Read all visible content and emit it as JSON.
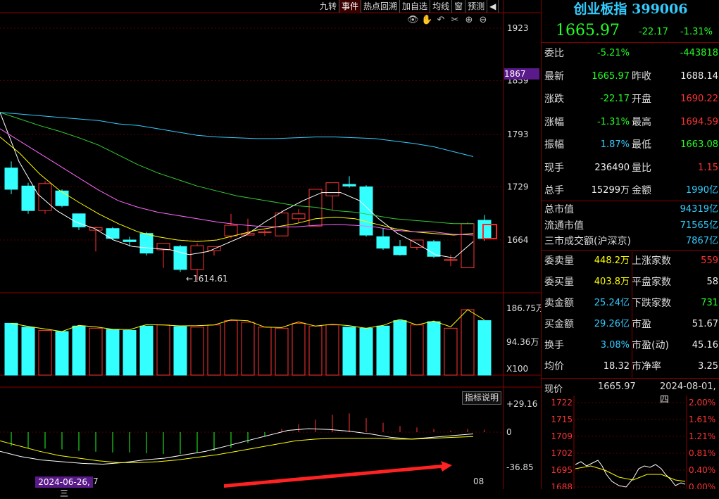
{
  "toolbar": [
    "九转",
    "事件",
    "热点回溯",
    "加自选",
    "均线",
    "窗",
    "预测"
  ],
  "toolbar_active": 1,
  "chart_tools": [
    "eye-icon",
    "hand-icon",
    "undo-icon",
    "scissors-icon",
    "zoom-in-icon",
    "zoom-out-icon"
  ],
  "price_axis": {
    "labels": [
      "1923",
      "1859",
      "1793",
      "1729",
      "1664"
    ],
    "current": "1867"
  },
  "low_marker": "1614.61",
  "vol_axis": [
    "186.75万",
    "94.36万",
    "X100"
  ],
  "macd_axis": [
    "+29.16",
    "0",
    "-36.85"
  ],
  "brief_label": "指标说明",
  "bottom": {
    "date": "2024-06-26,三",
    "date_tail": "7",
    "end": "08"
  },
  "colors": {
    "up": "#f33",
    "down": "#3ff",
    "ma5": "#fff",
    "ma10": "#ff0",
    "ma20": "#f6f",
    "ma30": "#3c3",
    "ma60": "#3cf"
  },
  "chart_data": {
    "type": "candlestick",
    "candles": [
      {
        "o": 1752,
        "h": 1760,
        "l": 1720,
        "c": 1726
      },
      {
        "o": 1730,
        "h": 1734,
        "l": 1696,
        "c": 1700
      },
      {
        "o": 1700,
        "h": 1736,
        "l": 1696,
        "c": 1733
      },
      {
        "o": 1724,
        "h": 1726,
        "l": 1704,
        "c": 1706
      },
      {
        "o": 1696,
        "h": 1696,
        "l": 1676,
        "c": 1680
      },
      {
        "o": 1676,
        "h": 1680,
        "l": 1650,
        "c": 1679
      },
      {
        "o": 1678,
        "h": 1680,
        "l": 1664,
        "c": 1666
      },
      {
        "o": 1664,
        "h": 1668,
        "l": 1656,
        "c": 1662
      },
      {
        "o": 1672,
        "h": 1674,
        "l": 1645,
        "c": 1648
      },
      {
        "o": 1652,
        "h": 1660,
        "l": 1630,
        "c": 1660
      },
      {
        "o": 1656,
        "h": 1658,
        "l": 1625,
        "c": 1628
      },
      {
        "o": 1628,
        "h": 1660,
        "l": 1614.61,
        "c": 1657
      },
      {
        "o": 1651,
        "h": 1656,
        "l": 1645,
        "c": 1656
      },
      {
        "o": 1669,
        "h": 1696,
        "l": 1666,
        "c": 1682
      },
      {
        "o": 1670,
        "h": 1690,
        "l": 1670,
        "c": 1672
      },
      {
        "o": 1674,
        "h": 1676,
        "l": 1669,
        "c": 1674
      },
      {
        "o": 1669,
        "h": 1700,
        "l": 1669,
        "c": 1697
      },
      {
        "o": 1690,
        "h": 1702,
        "l": 1685,
        "c": 1696
      },
      {
        "o": 1681,
        "h": 1726,
        "l": 1681,
        "c": 1726
      },
      {
        "o": 1718,
        "h": 1734,
        "l": 1700,
        "c": 1734
      },
      {
        "o": 1732,
        "h": 1742,
        "l": 1728,
        "c": 1730
      },
      {
        "o": 1729,
        "h": 1731,
        "l": 1668,
        "c": 1670
      },
      {
        "o": 1668,
        "h": 1678,
        "l": 1652,
        "c": 1654
      },
      {
        "o": 1656,
        "h": 1664,
        "l": 1645,
        "c": 1646
      },
      {
        "o": 1655,
        "h": 1664,
        "l": 1652,
        "c": 1664
      },
      {
        "o": 1662,
        "h": 1664,
        "l": 1642,
        "c": 1644
      },
      {
        "o": 1640,
        "h": 1646,
        "l": 1632,
        "c": 1640
      },
      {
        "o": 1630,
        "h": 1686,
        "l": 1630,
        "c": 1684
      },
      {
        "o": 1688.14,
        "h": 1694.59,
        "l": 1663.08,
        "c": 1665.97
      }
    ],
    "ma": [
      {
        "name": "MA5",
        "points": [
          1820,
          1760,
          1720,
          1700,
          1686,
          1678,
          1664,
          1656,
          1654,
          1652,
          1646,
          1650,
          1660,
          1670,
          1686,
          1700,
          1712,
          1722,
          1722,
          1712,
          1690,
          1672,
          1660,
          1646,
          1642,
          1662
        ]
      },
      {
        "name": "MA10",
        "points": [
          1790,
          1770,
          1745,
          1725,
          1710,
          1696,
          1684,
          1674,
          1668,
          1664,
          1662,
          1664,
          1670,
          1676,
          1680,
          1684,
          1690,
          1692,
          1690,
          1684,
          1678,
          1674,
          1672,
          1670,
          1672
        ]
      },
      {
        "name": "MA20",
        "points": [
          1800,
          1785,
          1770,
          1755,
          1740,
          1725,
          1712,
          1704,
          1698,
          1694,
          1690,
          1686,
          1683,
          1681,
          1680,
          1680,
          1682,
          1683,
          1682,
          1680,
          1676,
          1674,
          1674,
          1671,
          1670
        ]
      },
      {
        "name": "MA30",
        "points": [
          1820,
          1812,
          1804,
          1797,
          1789,
          1780,
          1768,
          1756,
          1746,
          1738,
          1730,
          1724,
          1718,
          1714,
          1710,
          1706,
          1704,
          1700,
          1698,
          1694,
          1690,
          1688,
          1686,
          1684,
          1684
        ]
      },
      {
        "name": "MA60",
        "points": [
          1820,
          1818,
          1816,
          1814,
          1812,
          1810,
          1806,
          1804,
          1800,
          1796,
          1792,
          1790,
          1789,
          1788,
          1788,
          1789,
          1790,
          1790,
          1789,
          1788,
          1785,
          1782,
          1778,
          1772,
          1766
        ]
      }
    ],
    "volumes": [
      95,
      88,
      82,
      80,
      90,
      86,
      84,
      82,
      90,
      92,
      89,
      88,
      92,
      100,
      97,
      88,
      86,
      95,
      90,
      92,
      88,
      86,
      90,
      100,
      92,
      98,
      86,
      120,
      100
    ],
    "macd_bars": [
      -18,
      -20,
      -21,
      -22,
      -24,
      -25,
      -26,
      -26,
      -27,
      -28,
      -28,
      -26,
      -24,
      -20,
      -14,
      -6,
      4,
      10,
      16,
      22,
      24,
      18,
      12,
      8,
      6,
      4,
      2,
      4,
      3
    ],
    "macd_dif": [
      -22,
      -28,
      -32,
      -34,
      -36,
      -36.85,
      -35,
      -32,
      -30,
      -26,
      -22,
      -16,
      -10,
      -4,
      2,
      4,
      3,
      1,
      -2,
      -6,
      -8,
      -6,
      -4,
      -2
    ],
    "macd_dea": [
      -10,
      -16,
      -22,
      -27,
      -30,
      -33,
      -35,
      -35,
      -34,
      -32,
      -29,
      -26,
      -22,
      -18,
      -14,
      -10,
      -8,
      -7,
      -7,
      -7,
      -8,
      -8,
      -7,
      -6,
      -5
    ]
  },
  "panel": {
    "title": "创业板指 399006",
    "price": "1665.97",
    "chg": "-22.17",
    "pct": "-1.31%",
    "rows1": [
      {
        "l": "委比",
        "v1": "-5.21%",
        "c1": "g",
        "v2": "-443818",
        "c2": "g"
      },
      {
        "l": "最新",
        "v1": "1665.97",
        "c1": "g",
        "l2": "昨收",
        "v2": "1688.14",
        "c2": "w"
      },
      {
        "l": "涨跌",
        "v1": "-22.17",
        "c1": "g",
        "l2": "开盘",
        "v2": "1690.22",
        "c2": "r"
      },
      {
        "l": "涨幅",
        "v1": "-1.31%",
        "c1": "g",
        "l2": "最高",
        "v2": "1694.59",
        "c2": "r"
      },
      {
        "l": "振幅",
        "v1": "1.87%",
        "c1": "c",
        "l2": "最低",
        "v2": "1663.08",
        "c2": "g"
      },
      {
        "l": "现手",
        "v1": "236490",
        "c1": "w",
        "l2": "量比",
        "v2": "1.15",
        "c2": "r"
      },
      {
        "l": "总手",
        "v1": "15299万",
        "c1": "w",
        "l2": "金额",
        "v2": "1990亿",
        "c2": "c"
      }
    ],
    "rows2": [
      {
        "l": "总市值",
        "v": "94319亿"
      },
      {
        "l": "流通市值",
        "v": "71565亿"
      },
      {
        "l": "三市成交额(沪深京)",
        "v": "7867亿"
      }
    ],
    "rows3": [
      {
        "l": "委卖量",
        "v1": "448.2万",
        "c1": "y",
        "l2": "上涨家数",
        "v2": "559",
        "c2": "r"
      },
      {
        "l": "委买量",
        "v1": "403.8万",
        "c1": "y",
        "l2": "平盘家数",
        "v2": "58",
        "c2": "w"
      },
      {
        "l": "卖金额",
        "v1": "25.24亿",
        "c1": "c",
        "l2": "下跌家数",
        "v2": "731",
        "c2": "g"
      },
      {
        "l": "买金额",
        "v1": "29.26亿",
        "c1": "c",
        "l2": "市盈",
        "v2": "51.67",
        "c2": "w"
      },
      {
        "l": "换手",
        "v1": "3.08%",
        "c1": "c",
        "l2": "市盈(动)",
        "v2": "45.16",
        "c2": "w"
      },
      {
        "l": "均价",
        "v1": "18.32",
        "c1": "w",
        "l2": "市净率",
        "v2": "3.25",
        "c2": "w"
      }
    ],
    "tick": {
      "label": "现价",
      "price": "1665.97",
      "date": "2024-08-01,四",
      "y_labels": [
        "1722",
        "1715",
        "1709",
        "1702",
        "1695",
        "1688"
      ],
      "pct_labels": [
        "2.00%",
        "1.61%",
        "1.21%",
        "0.81%",
        "0.40%",
        "0.00%"
      ]
    }
  }
}
